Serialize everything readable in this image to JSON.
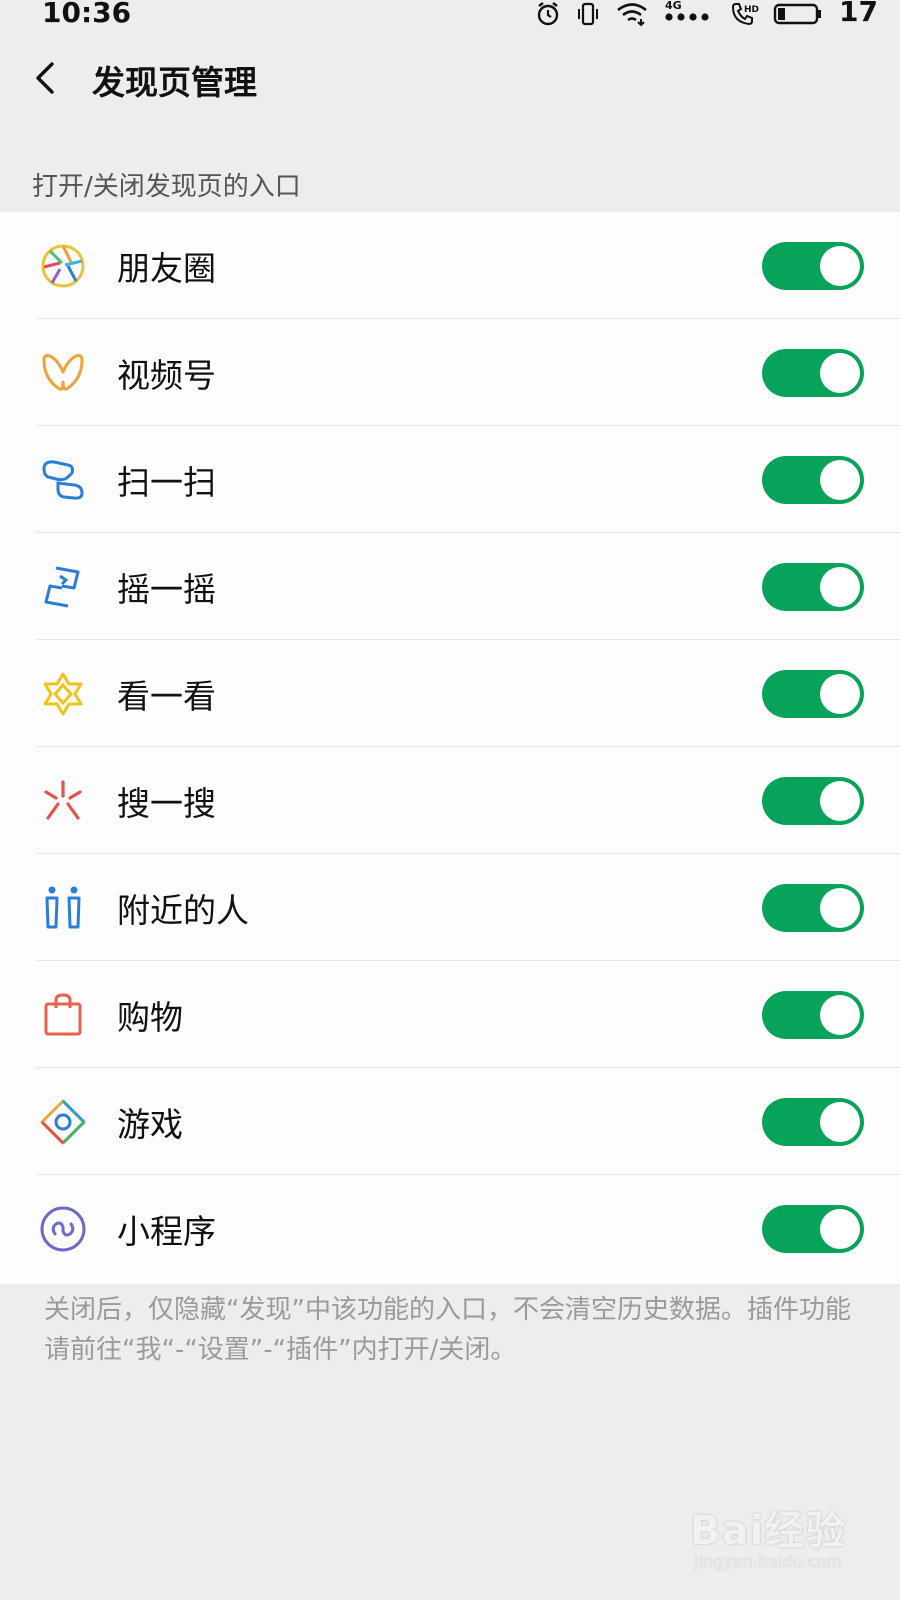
{
  "status_bar": {
    "time": "10:36",
    "network": "4G",
    "battery_level": "17",
    "icons": [
      "alarm-icon",
      "vibrate-icon",
      "wifi-icon",
      "signal-icon",
      "hd-call-icon",
      "battery-icon"
    ]
  },
  "header": {
    "back_icon": "chevron-left-icon",
    "title": "发现页管理"
  },
  "section_label": "打开/关闭发现页的入口",
  "items": [
    {
      "label": "朋友圈",
      "icon": "moments-aperture-icon",
      "enabled": true
    },
    {
      "label": "视频号",
      "icon": "channels-butterfly-icon",
      "enabled": true
    },
    {
      "label": "扫一扫",
      "icon": "scan-icon",
      "enabled": true
    },
    {
      "label": "摇一摇",
      "icon": "shake-icon",
      "enabled": true
    },
    {
      "label": "看一看",
      "icon": "top-stories-star-icon",
      "enabled": true
    },
    {
      "label": "搜一搜",
      "icon": "search-sparkle-icon",
      "enabled": true
    },
    {
      "label": "附近的人",
      "icon": "people-nearby-icon",
      "enabled": true
    },
    {
      "label": "购物",
      "icon": "shopping-bag-icon",
      "enabled": true
    },
    {
      "label": "游戏",
      "icon": "games-diamond-icon",
      "enabled": true
    },
    {
      "label": "小程序",
      "icon": "mini-program-icon",
      "enabled": true
    }
  ],
  "footer_note": "关闭后，仅隐藏“发现”中该功能的入口，不会清空历史数据。插件功能请前往“我“-“设置”-“插件”内打开/关闭。",
  "watermark": {
    "main": "Bai经验",
    "sub": "jingyan.baidu.com"
  },
  "colors": {
    "toggle_on": "#07a35a",
    "page_bg": "#ededed",
    "list_bg": "#fdfdfd"
  }
}
